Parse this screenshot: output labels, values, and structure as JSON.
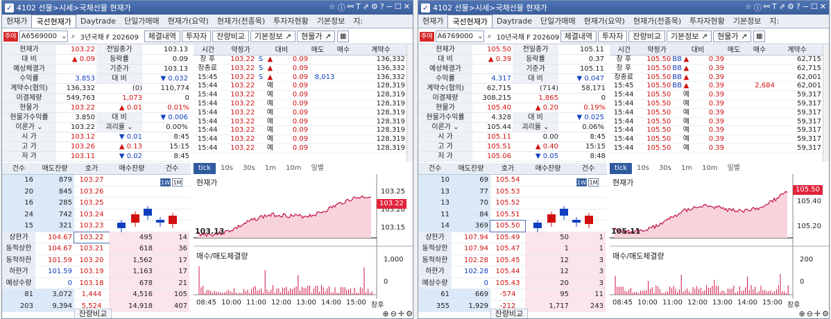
{
  "colors": {
    "up": "#d01010",
    "down": "#1040c0",
    "title": "#3b5d9a"
  },
  "panels": [
    {
      "title": "4102 선물>시세>국채선물 현재가",
      "tabs": [
        "현재가",
        "국선현재가",
        "Daytrade",
        "단일가매매",
        "현재가(요약)",
        "현재가(전종목)",
        "투자자현황",
        "기본정보",
        "지:"
      ],
      "code": "A6569000",
      "product": "3년국채 F 202609",
      "buttons": [
        "체결내역",
        "투자자",
        "잔량비교",
        "기본정보 ↗",
        "현물가 ↗"
      ],
      "quote": [
        [
          "현재가",
          "103.22",
          "전일종가",
          "103.13"
        ],
        [
          "대    비",
          "▲ 0.09",
          "등락률",
          "0.09"
        ],
        [
          "예상체결가",
          "",
          "기준가",
          "103.13"
        ],
        [
          "수익률",
          "3.853",
          "대    비",
          "▼ 0.032"
        ],
        [
          "계약수(협의)",
          "136,332",
          "(0)",
          "110,774"
        ],
        [
          "미결제량",
          "549,763",
          "1,073",
          "0"
        ],
        [
          "현물가",
          "103.22",
          "▲ 0.01",
          "0.01%"
        ],
        [
          "현물가수익률",
          "3.850",
          "대    비",
          "▼ 0.006"
        ],
        [
          "이론가 ⌄",
          "103.22",
          "괴리율 ⌄",
          "0.00%"
        ],
        [
          "시    가",
          "103.12",
          "▼ 0.01",
          "8:45"
        ],
        [
          "고    가",
          "103.26",
          "▲ 0.13",
          "15:15"
        ],
        [
          "저    가",
          "103.11",
          "▼ 0.02",
          "8:45"
        ]
      ],
      "trades_header": [
        "시간",
        "약정가",
        "대비",
        "매도",
        "매수",
        "계약수"
      ],
      "trades": [
        [
          "장 후",
          "103.22",
          "S",
          "▲",
          "0.09",
          "",
          "",
          "136,332"
        ],
        [
          "장종료",
          "103.22",
          "S",
          "▲",
          "0.09",
          "",
          "",
          "136,332"
        ],
        [
          "15:45",
          "103.22",
          "S",
          "▲",
          "0.09",
          "8,013",
          "",
          "136,332"
        ],
        [
          "15:44",
          "103.22",
          "",
          "예",
          "0.09",
          "",
          "",
          "128,319"
        ],
        [
          "15:44",
          "103.22",
          "",
          "예",
          "0.09",
          "",
          "",
          "128,319"
        ],
        [
          "15:44",
          "103.22",
          "",
          "예",
          "0.09",
          "",
          "",
          "128,319"
        ],
        [
          "15:44",
          "103.22",
          "",
          "예",
          "0.09",
          "",
          "",
          "128,319"
        ],
        [
          "15:44",
          "103.22",
          "",
          "예",
          "0.09",
          "",
          "",
          "128,319"
        ],
        [
          "15:44",
          "103.22",
          "",
          "예",
          "0.09",
          "",
          "",
          "128,319"
        ],
        [
          "15:44",
          "103.22",
          "",
          "예",
          "0.09",
          "",
          "",
          "128,319"
        ],
        [
          "15:44",
          "103.22",
          "",
          "예",
          "0.09",
          "",
          "",
          "128,319"
        ]
      ],
      "ob_header": [
        "건수",
        "매도잔량",
        "호가",
        "매수잔량",
        "건수"
      ],
      "asks": [
        [
          "16",
          "879",
          "103.27"
        ],
        [
          "20",
          "845",
          "103.26"
        ],
        [
          "16",
          "285",
          "103.25"
        ],
        [
          "24",
          "742",
          "103.24"
        ],
        [
          "15",
          "321",
          "103.23"
        ]
      ],
      "bids": [
        [
          "103.22",
          "495",
          "14"
        ],
        [
          "103.21",
          "618",
          "36"
        ],
        [
          "103.20",
          "1,562",
          "17"
        ],
        [
          "103.19",
          "1,163",
          "17"
        ],
        [
          "103.18",
          "678",
          "21"
        ]
      ],
      "limits": [
        [
          "상한가",
          "104.67"
        ],
        [
          "동적상한",
          "104.67"
        ],
        [
          "동적하한",
          "101.59"
        ],
        [
          "하한가",
          "101.59"
        ],
        [
          "예상수량",
          "0"
        ]
      ],
      "totals": [
        "81",
        "3,072",
        "1,444",
        "4,516",
        "105"
      ],
      "totals2": [
        "203",
        "9,394",
        "5,524",
        "14,918",
        "407"
      ],
      "ob_bottom": "잔량비교",
      "chart": {
        "tabs": [
          "tick",
          "10s",
          "30s",
          "1m",
          "10m",
          "일별"
        ],
        "price_label": "현재가",
        "vol_label": "매수/매도체결량",
        "price_ticks": [
          "103.25",
          "103.20",
          "103.15"
        ],
        "vol_ticks": [
          "1,000",
          "0"
        ],
        "low_mark": "103.13",
        "cur_badge": "103.22",
        "times": [
          "08:45",
          "10:00",
          "11:00",
          "12:00",
          "13:00",
          "14:00",
          "15:00",
          "장후"
        ],
        "wm": [
          "1W",
          "1M"
        ]
      }
    },
    {
      "title": "4102 선물>시세>국채선물 현재가",
      "tabs": [
        "현재가",
        "국선현재가",
        "Daytrade",
        "단일가매매",
        "현재가(요약)",
        "현재가(전종목)",
        "투자자현황",
        "기본정보",
        "지:"
      ],
      "code": "A6769000",
      "product": "10년국채 F 202609",
      "buttons": [
        "체결내역",
        "투자자",
        "잔량비교",
        "기본정보 ↗",
        "현물가 ↗"
      ],
      "quote": [
        [
          "현재가",
          "105.50",
          "전일종가",
          "105.11"
        ],
        [
          "대    비",
          "▲ 0.39",
          "등락률",
          "0.37"
        ],
        [
          "예상체결가",
          "",
          "기준가",
          "105.11"
        ],
        [
          "수익률",
          "4.317",
          "대    비",
          "▼ 0.047"
        ],
        [
          "계약수(협의)",
          "62,715",
          "(714)",
          "58,171"
        ],
        [
          "미결제량",
          "308,215",
          "1,865",
          "0"
        ],
        [
          "현물가",
          "105.40",
          "▲ 0.20",
          "0.19%"
        ],
        [
          "현물가수익률",
          "4.328",
          "대    비",
          "▼ 0.025"
        ],
        [
          "이론가 ⌄",
          "105.44",
          "괴리율 ⌄",
          "0.06%"
        ],
        [
          "시    가",
          "105.11",
          "0.00",
          "8:45"
        ],
        [
          "고    가",
          "105.51",
          "▲ 0.40",
          "15:15"
        ],
        [
          "저    가",
          "105.06",
          "▼ 0.05",
          "8:48"
        ]
      ],
      "trades_header": [
        "시간",
        "약정가",
        "대비",
        "매도",
        "매수",
        "계약수"
      ],
      "trades": [
        [
          "장 후",
          "105.50",
          "BB",
          "▲",
          "0.39",
          "",
          "",
          "62,715"
        ],
        [
          "장 후",
          "105.50",
          "BB",
          "▲",
          "0.39",
          "",
          "",
          "62,715"
        ],
        [
          "장종료",
          "105.50",
          "BB",
          "▲",
          "0.39",
          "",
          "",
          "62,001"
        ],
        [
          "15:45",
          "105.50",
          "BB",
          "▲",
          "0.39",
          "",
          "2,684",
          "62,001"
        ],
        [
          "15:44",
          "105.50",
          "",
          "예",
          "0.39",
          "",
          "",
          "59,317"
        ],
        [
          "15:44",
          "105.50",
          "",
          "예",
          "0.39",
          "",
          "",
          "59,317"
        ],
        [
          "15:44",
          "105.50",
          "",
          "예",
          "0.39",
          "",
          "",
          "59,317"
        ],
        [
          "15:44",
          "105.50",
          "",
          "예",
          "0.39",
          "",
          "",
          "59,317"
        ],
        [
          "15:44",
          "105.50",
          "",
          "예",
          "0.39",
          "",
          "",
          "59,317"
        ],
        [
          "15:44",
          "105.50",
          "",
          "예",
          "0.39",
          "",
          "",
          "59,317"
        ],
        [
          "15:44",
          "105.50",
          "",
          "예",
          "0.39",
          "",
          "",
          "59,317"
        ]
      ],
      "ob_header": [
        "건수",
        "매도잔량",
        "호가",
        "매수잔량",
        "건수"
      ],
      "asks": [
        [
          "10",
          "69",
          "105.54"
        ],
        [
          "13",
          "77",
          "105.53"
        ],
        [
          "13",
          "70",
          "105.52"
        ],
        [
          "11",
          "84",
          "105.51"
        ],
        [
          "14",
          "369",
          "105.50"
        ]
      ],
      "bids": [
        [
          "105.49",
          "50",
          "1"
        ],
        [
          "105.47",
          "1",
          "1"
        ],
        [
          "105.45",
          "12",
          "3"
        ],
        [
          "105.44",
          "12",
          "3"
        ],
        [
          "105.43",
          "20",
          "3"
        ]
      ],
      "limits": [
        [
          "상한가",
          "107.94"
        ],
        [
          "동적상한",
          "107.94"
        ],
        [
          "동적하한",
          "102.28"
        ],
        [
          "하한가",
          "102.28"
        ],
        [
          "예상수량",
          "0"
        ]
      ],
      "totals": [
        "61",
        "669",
        "-574",
        "95",
        "11"
      ],
      "totals2": [
        "355",
        "1,929",
        "-212",
        "1,717",
        "243"
      ],
      "ob_bottom": "잔량비교",
      "chart": {
        "tabs": [
          "tick",
          "10s",
          "30s",
          "1m",
          "10m",
          "일별"
        ],
        "price_label": "현재가",
        "vol_label": "매수/매도체결량",
        "price_ticks": [
          "105.40",
          "105.20"
        ],
        "vol_ticks": [
          "200",
          "0"
        ],
        "low_mark": "105.11",
        "cur_badge": "105.50",
        "times": [
          "08:45",
          "10:00",
          "11:00",
          "12:00",
          "13:00",
          "14:00",
          "15:00",
          "장후"
        ],
        "wm": [
          "1W",
          "1M"
        ]
      }
    }
  ]
}
